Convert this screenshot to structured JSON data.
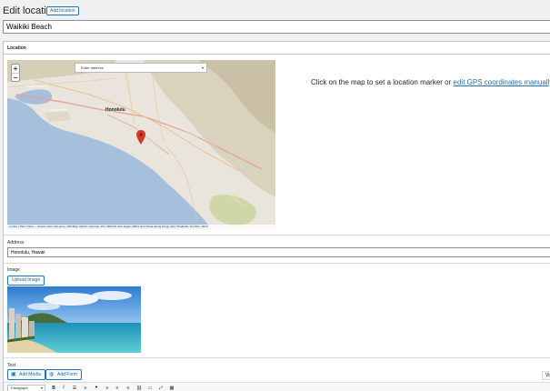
{
  "header": {
    "title": "Edit location",
    "add_label": "Add location"
  },
  "title_field": {
    "value": "Waikiki Beach"
  },
  "location_box": {
    "heading": "Location",
    "map": {
      "zoom_in": "+",
      "zoom_out": "−",
      "search_placeholder": "Enter address",
      "labels": {
        "city": "Honolulu",
        "lagoon": "Keehi Lagoon",
        "island": "Sand Island"
      },
      "attribution_link": "Leaflet",
      "attribution_text": " | Tiles © Esri — Source: Esri, DeLorme, NAVTEQ, USGS, Intermap, iPC, NRCAN, Esri Japan, METI, Esri China (Hong Kong), Esri (Thailand), TomTom, 2012"
    },
    "hint_text": "Click on the map to set a location marker or ",
    "hint_link": "edit GPS coordinates manually",
    "hint_end": "."
  },
  "address": {
    "label": "Address",
    "value": "Honolulu, Hawaii"
  },
  "image": {
    "label": "Image",
    "upload_label": "Upload Image"
  },
  "text": {
    "label": "Text",
    "add_media": "Add Media",
    "add_form": "Add Form",
    "visual_tab": "Vis",
    "format_select": "Paragraph"
  },
  "toolbar_icons": [
    "bold-icon",
    "italic-icon",
    "bullet-list-icon",
    "numbered-list-icon",
    "blockquote-icon",
    "align-left-icon",
    "align-center-icon",
    "align-right-icon",
    "link-icon",
    "read-more-icon",
    "fullscreen-icon",
    "toolbar-toggle-icon"
  ],
  "colors": {
    "accent": "#2271b1",
    "marker": "#d23a2d",
    "water": "#a5bfdd",
    "land": "#e9e5dc"
  }
}
